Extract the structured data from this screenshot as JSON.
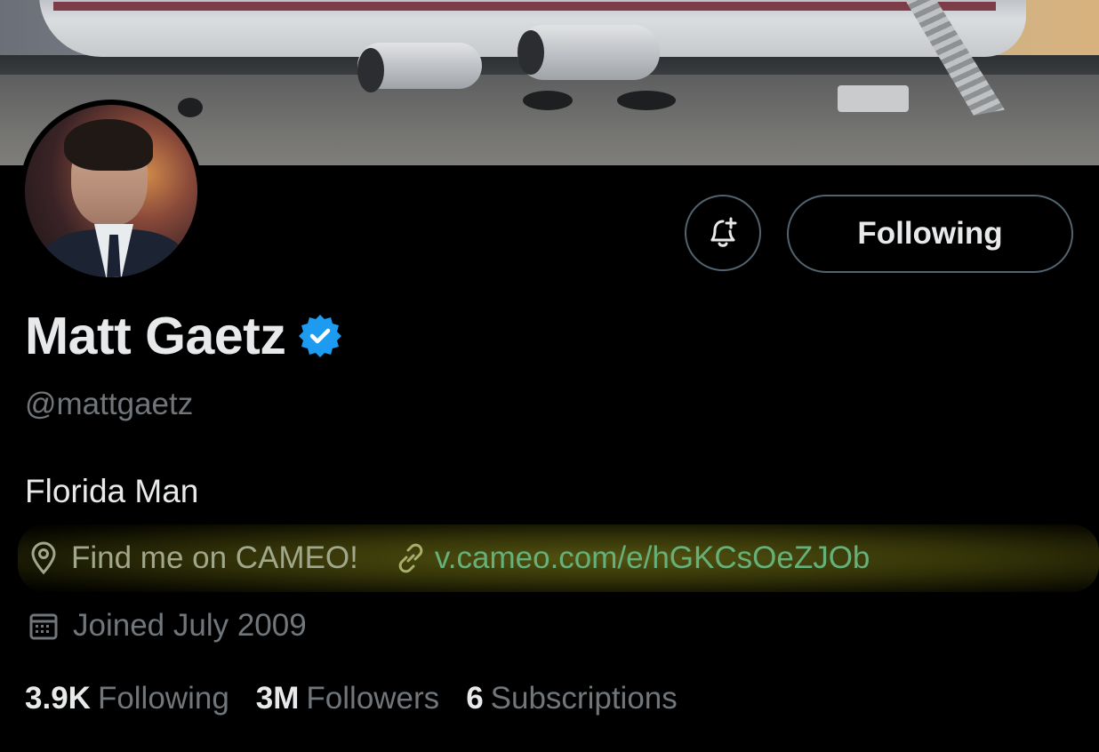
{
  "profile": {
    "name": "Matt Gaetz",
    "handle": "@mattgaetz",
    "bio": "Florida Man",
    "location": "Find me on CAMEO!",
    "url": "v.cameo.com/e/hGKCsOeZJOb",
    "joined": "Joined July 2009",
    "verified": true
  },
  "actions": {
    "notify_icon": "bell-plus-icon",
    "following_label": "Following"
  },
  "stats": [
    {
      "value": "3.9K",
      "label": "Following"
    },
    {
      "value": "3M",
      "label": "Followers"
    },
    {
      "value": "6",
      "label": "Subscriptions"
    }
  ],
  "colors": {
    "background": "#000000",
    "text_primary": "#e7e9ea",
    "text_secondary": "#71767b",
    "border": "#536471",
    "verified_badge": "#1d9bf0",
    "link_highlighted": "#66b07a",
    "highlight": "#8a8a1e"
  }
}
